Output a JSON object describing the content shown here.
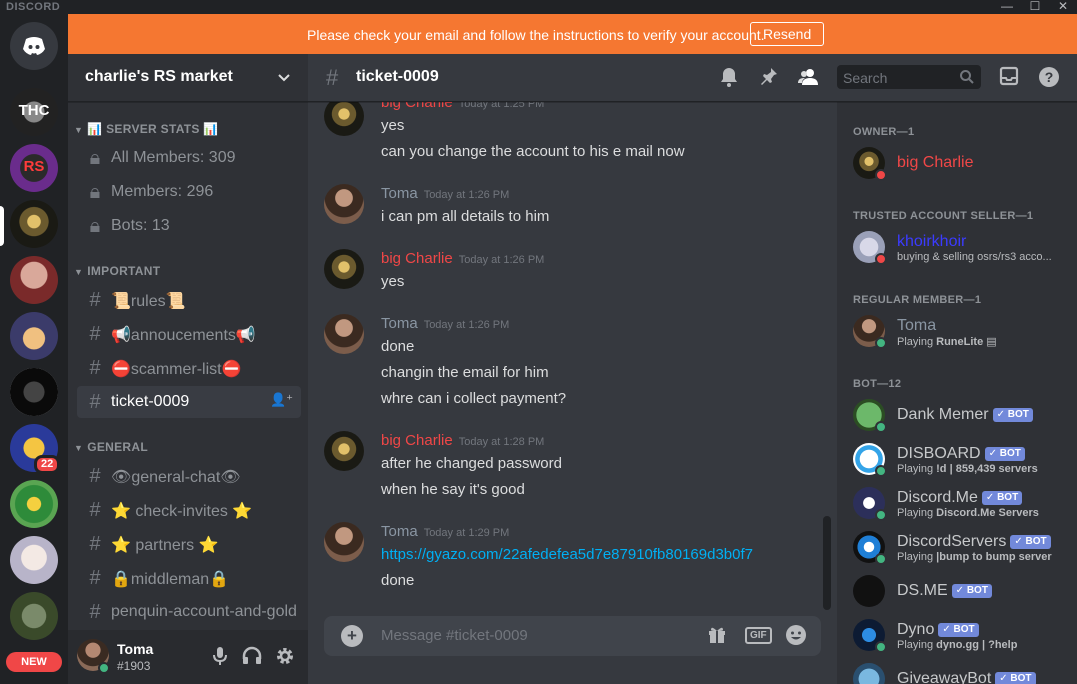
{
  "app": {
    "brand": "DISCORD"
  },
  "window_controls": {
    "minimize": "—",
    "maximize": "☐",
    "close": "✕"
  },
  "servers": {
    "home_label": "◉",
    "items": [
      {
        "label": "THC",
        "badge": ""
      },
      {
        "label": "RS",
        "badge": ""
      },
      {
        "label": "",
        "badge": ""
      },
      {
        "label": "",
        "badge": ""
      },
      {
        "label": "",
        "badge": ""
      },
      {
        "label": "",
        "badge": ""
      },
      {
        "label": "",
        "badge": "22"
      },
      {
        "label": "",
        "badge": ""
      },
      {
        "label": "",
        "badge": ""
      },
      {
        "label": "",
        "badge": ""
      }
    ],
    "new_label": "NEW"
  },
  "banner": {
    "text": "Please check your email and follow the instructions to verify your account.",
    "button": "Resend",
    "color": "#f57731"
  },
  "guild": {
    "name": "charlie's RS market"
  },
  "categories": [
    {
      "name": "📊 SERVER STATS 📊"
    },
    {
      "name": "IMPORTANT"
    },
    {
      "name": "GENERAL"
    }
  ],
  "channels": {
    "stats": [
      "All Members: 309",
      "Members: 296",
      "Bots: 13"
    ],
    "important": [
      "📜rules📜",
      "📢annoucements📢",
      "⛔scammer-list⛔",
      "ticket-0009"
    ],
    "general": [
      "👁general-chat👁",
      "⭐ check-invites ⭐",
      "⭐ partners ⭐",
      "🔒middleman🔒",
      "penquin-account-and-gold"
    ]
  },
  "user": {
    "name": "Toma",
    "tag": "#1903"
  },
  "chat": {
    "channel": "ticket-0009",
    "search_placeholder": "Search",
    "composer_placeholder": "Message #ticket-0009",
    "gif": "GIF",
    "messages": [
      {
        "author": "big Charlie",
        "time": "Today at 1:25 PM",
        "lines": [
          "yes",
          "can you change the account to his e mail now"
        ]
      },
      {
        "author": "Toma",
        "time": "Today at 1:26 PM",
        "lines": [
          "i can pm all details to him"
        ]
      },
      {
        "author": "big Charlie",
        "time": "Today at 1:26 PM",
        "lines": [
          "yes"
        ]
      },
      {
        "author": "Toma",
        "time": "Today at 1:26 PM",
        "lines": [
          "done",
          "changin the email for him",
          "whre can i collect payment?"
        ]
      },
      {
        "author": "big Charlie",
        "time": "Today at 1:28 PM",
        "lines": [
          "after he changed password",
          "when he say it's good"
        ]
      },
      {
        "author": "Toma",
        "time": "Today at 1:29 PM",
        "lines": [
          "https://gyazo.com/22afedefea5d7e87910fb80169d3b0f7",
          "done"
        ]
      }
    ]
  },
  "members": {
    "groups": [
      {
        "title": "OWNER—1"
      },
      {
        "title": "TRUSTED ACCOUNT SELLER—1"
      },
      {
        "title": "REGULAR MEMBER—1"
      },
      {
        "title": "BOT—12"
      }
    ],
    "owner": {
      "name": "big Charlie"
    },
    "trusted": {
      "name": "khoirkhoir",
      "activity": "buying & selling osrs/rs3 acco..."
    },
    "regular": {
      "name": "Toma",
      "activity_prefix": "Playing ",
      "activity_game": "RuneLite"
    },
    "bot_tag": "✓ BOT",
    "bots": [
      {
        "name": "Dank Memer",
        "prefix": "",
        "game": ""
      },
      {
        "name": "DISBOARD",
        "prefix": "Playing ",
        "game": "!d | 859,439 servers"
      },
      {
        "name": "Discord.Me",
        "prefix": "Playing ",
        "game": "Discord.Me Servers"
      },
      {
        "name": "DiscordServers",
        "prefix": "Playing ",
        "game": "|bump to bump server"
      },
      {
        "name": "DS.ME",
        "prefix": "",
        "game": ""
      },
      {
        "name": "Dyno",
        "prefix": "Playing ",
        "game": "dyno.gg | ?help"
      },
      {
        "name": "GiveawayBot",
        "prefix": "",
        "game": ""
      }
    ]
  }
}
